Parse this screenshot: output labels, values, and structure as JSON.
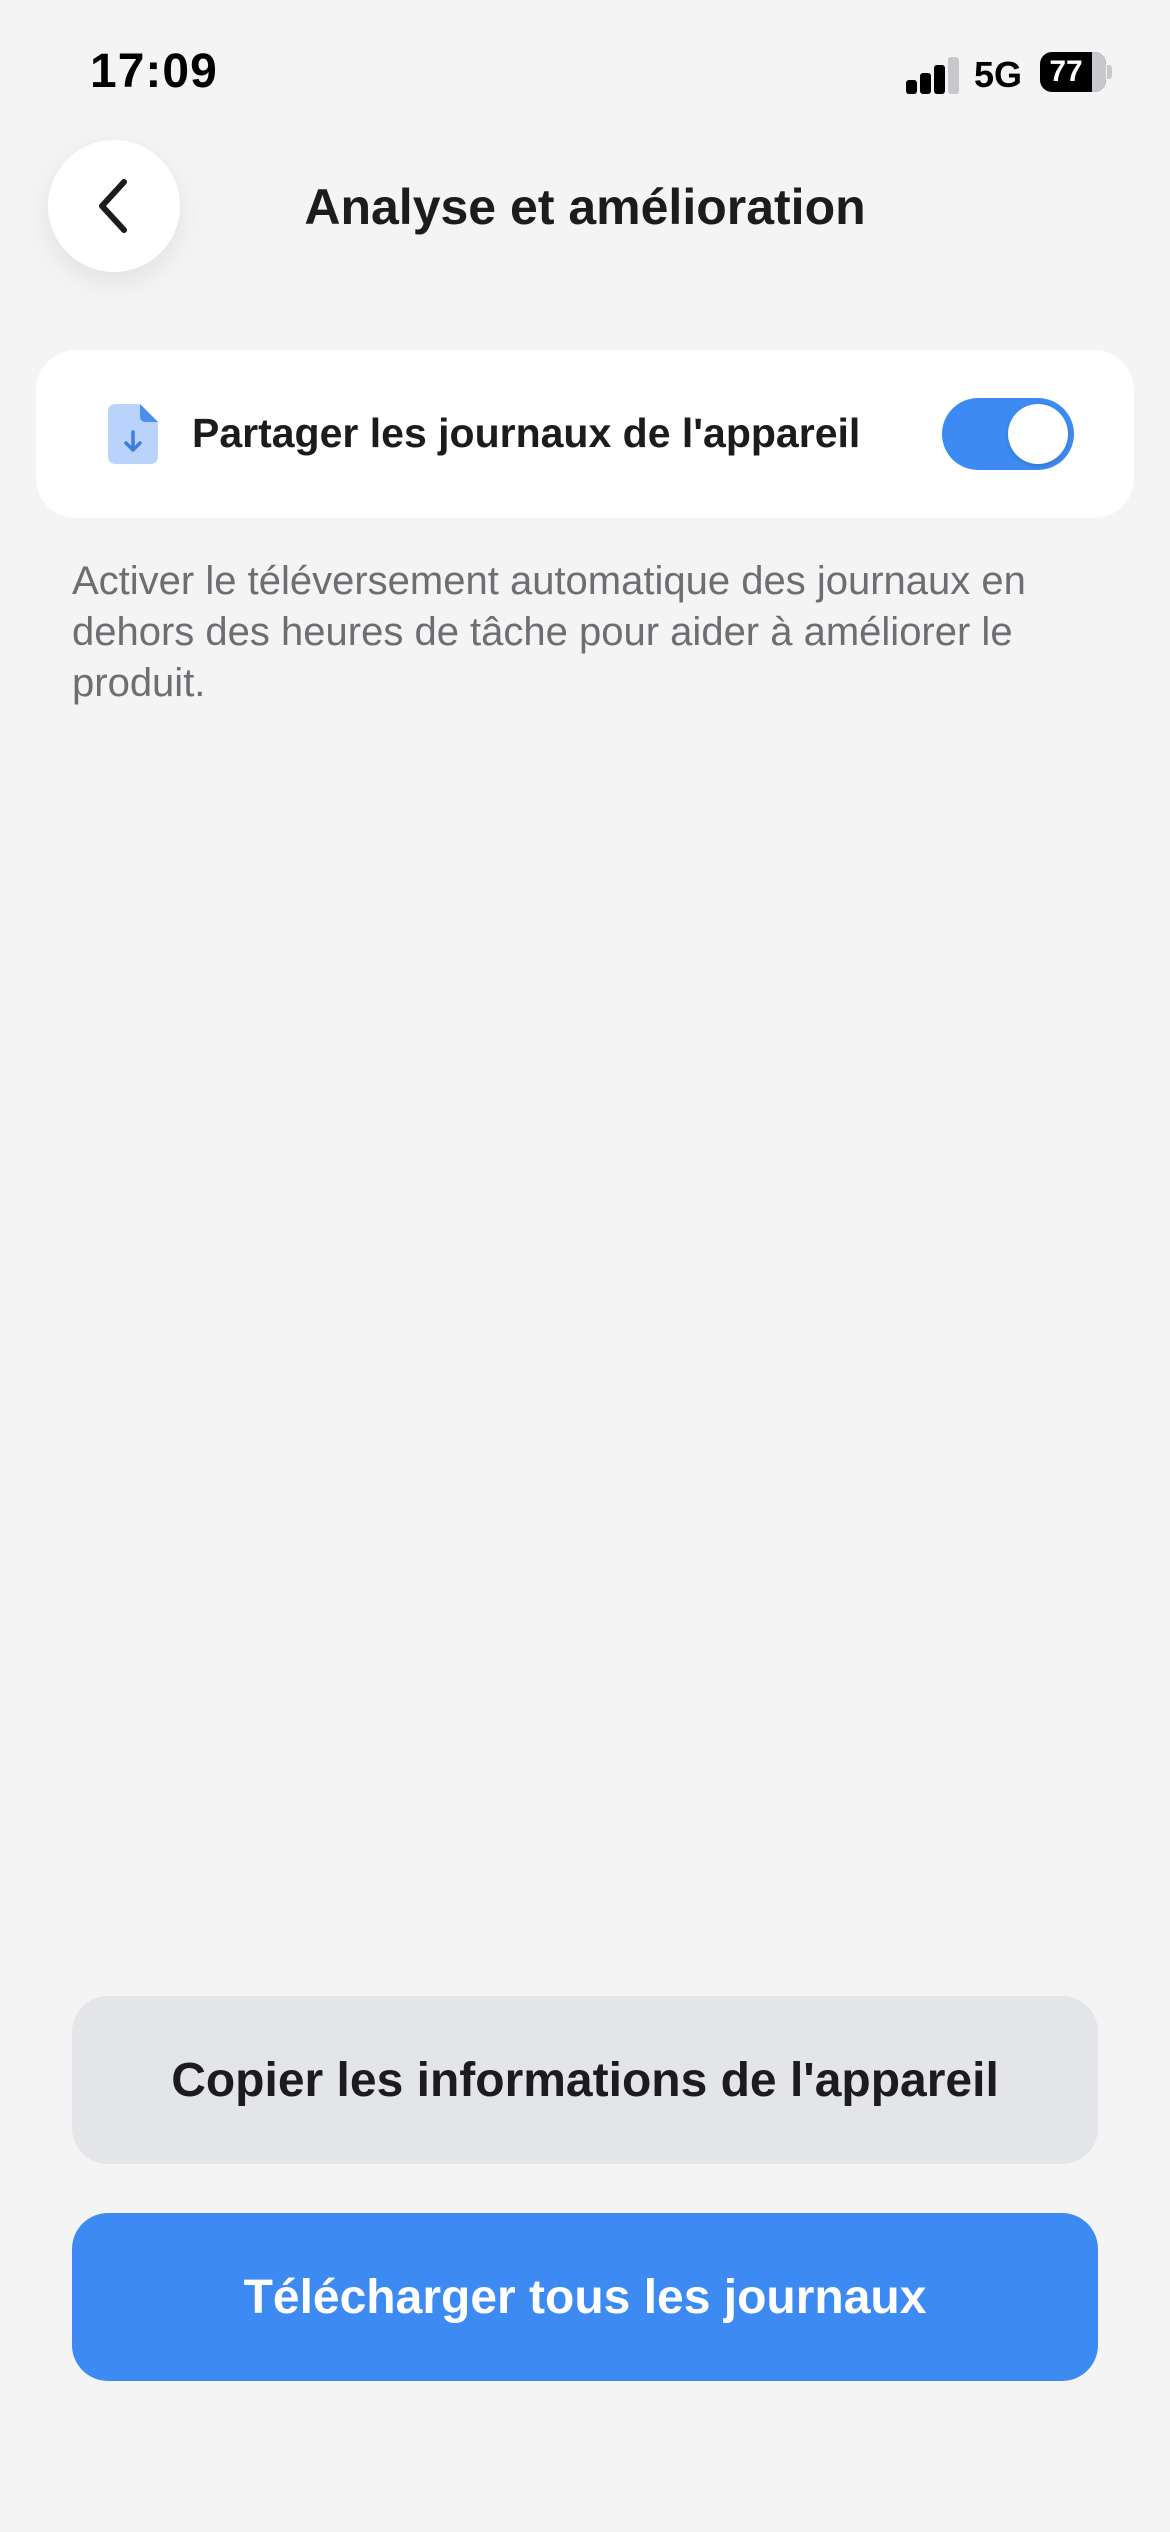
{
  "status_bar": {
    "time": "17:09",
    "network": "5G",
    "battery_level": "77",
    "signal_bars_active": 3,
    "signal_bars_total": 4
  },
  "header": {
    "back_icon": "chevron-left-icon",
    "title": "Analyse et amélioration"
  },
  "settings": {
    "share_logs": {
      "icon": "file-download-icon",
      "label": "Partager les journaux de l'appareil",
      "enabled": true
    },
    "description": "Activer le téléversement automatique des journaux en dehors des heures de tâche pour aider à améliorer le produit."
  },
  "actions": {
    "copy_label": "Copier les informations de l'appareil",
    "download_label": "Télécharger tous les journaux"
  },
  "colors": {
    "accent": "#3d8bf2",
    "background": "#f4f4f5",
    "card": "#ffffff",
    "secondary_button": "#e4e5e8",
    "description_text": "#6d6d72"
  }
}
